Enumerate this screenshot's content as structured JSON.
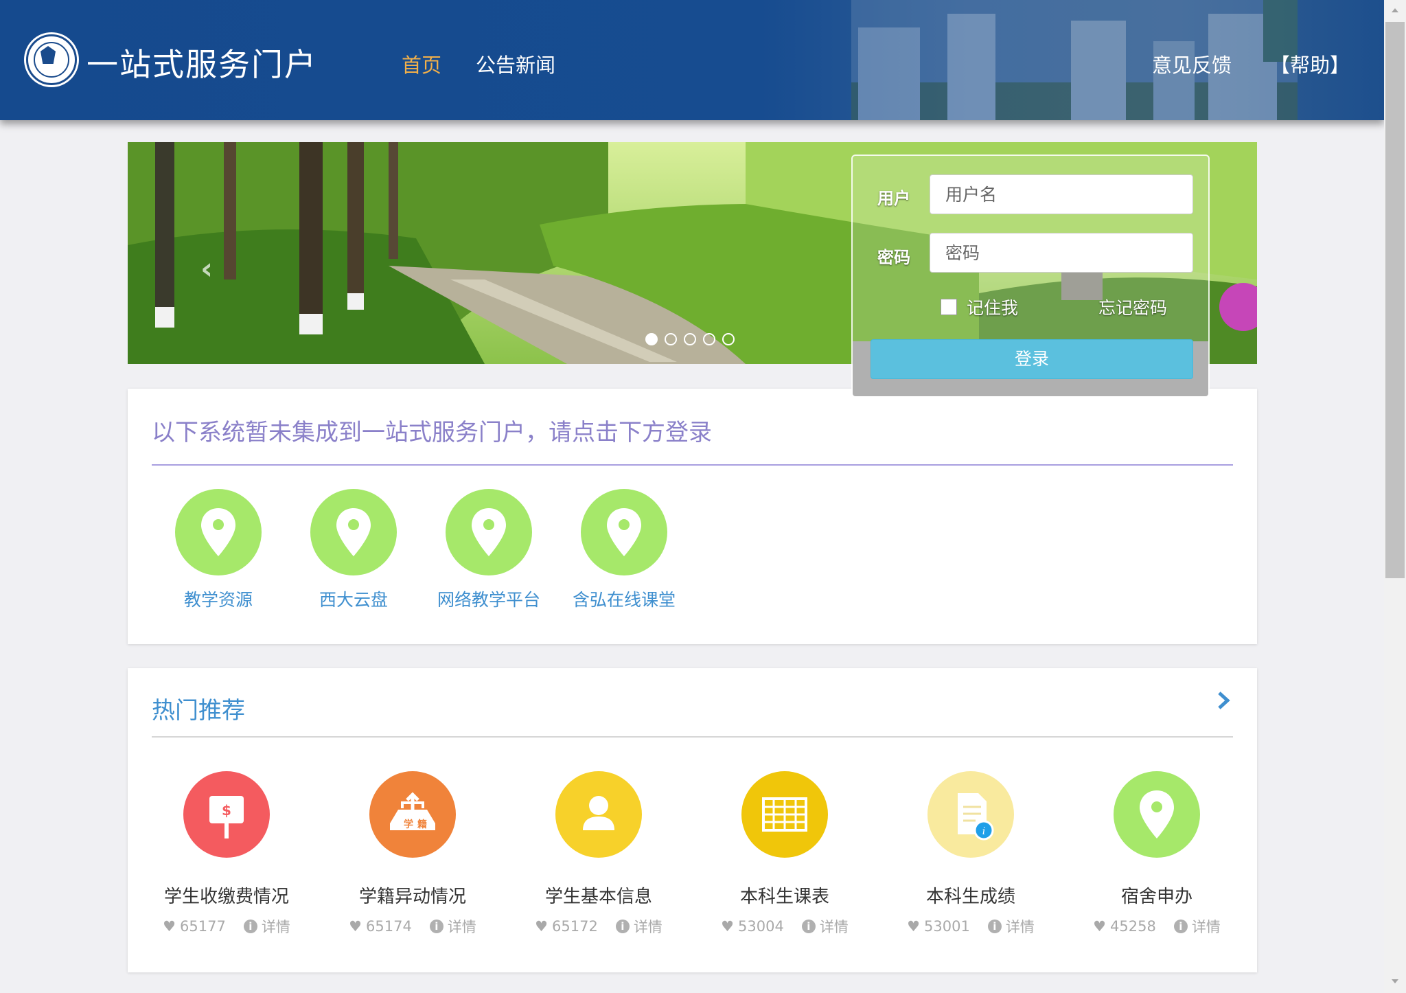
{
  "header": {
    "brand": "一站式服务门户",
    "nav": [
      {
        "label": "首页",
        "active": true
      },
      {
        "label": "公告新闻",
        "active": false
      }
    ],
    "nav_right": [
      {
        "label": "意见反馈"
      },
      {
        "label": "【帮助】"
      }
    ]
  },
  "login": {
    "user_label": "用户",
    "user_placeholder": "用户名",
    "pass_label": "密码",
    "pass_placeholder": "密码",
    "remember_label": "记住我",
    "forgot_label": "忘记密码",
    "submit_label": "登录"
  },
  "banner": {
    "slide_count": 5,
    "active_slide": 1
  },
  "systems_panel": {
    "title": "以下系统暂未集成到一站式服务门户，请点击下方登录",
    "items": [
      {
        "label": "教学资源",
        "icon": "map-pin-icon",
        "color": "#a6e86a"
      },
      {
        "label": "西大云盘",
        "icon": "map-pin-icon",
        "color": "#a6e86a"
      },
      {
        "label": "网络教学平台",
        "icon": "map-pin-icon",
        "color": "#a6e86a"
      },
      {
        "label": "含弘在线课堂",
        "icon": "map-pin-icon",
        "color": "#a6e86a"
      }
    ]
  },
  "hot_panel": {
    "title": "热门推荐",
    "detail_label": "详情",
    "items": [
      {
        "label": "学生收缴费情况",
        "likes": "65177",
        "icon": "payment-sign-icon",
        "color": "#f45b5f"
      },
      {
        "label": "学籍异动情况",
        "likes": "65174",
        "icon": "student-status-icon",
        "color": "#f0833a"
      },
      {
        "label": "学生基本信息",
        "likes": "65172",
        "icon": "user-icon",
        "color": "#f7d12a"
      },
      {
        "label": "本科生课表",
        "likes": "53004",
        "icon": "timetable-icon",
        "color": "#f0c60a"
      },
      {
        "label": "本科生成绩",
        "likes": "53001",
        "icon": "grade-document-icon",
        "color": "#f9ea9e"
      },
      {
        "label": "宿舍申办",
        "likes": "45258",
        "icon": "map-pin-icon",
        "color": "#a6e86a"
      }
    ]
  }
}
